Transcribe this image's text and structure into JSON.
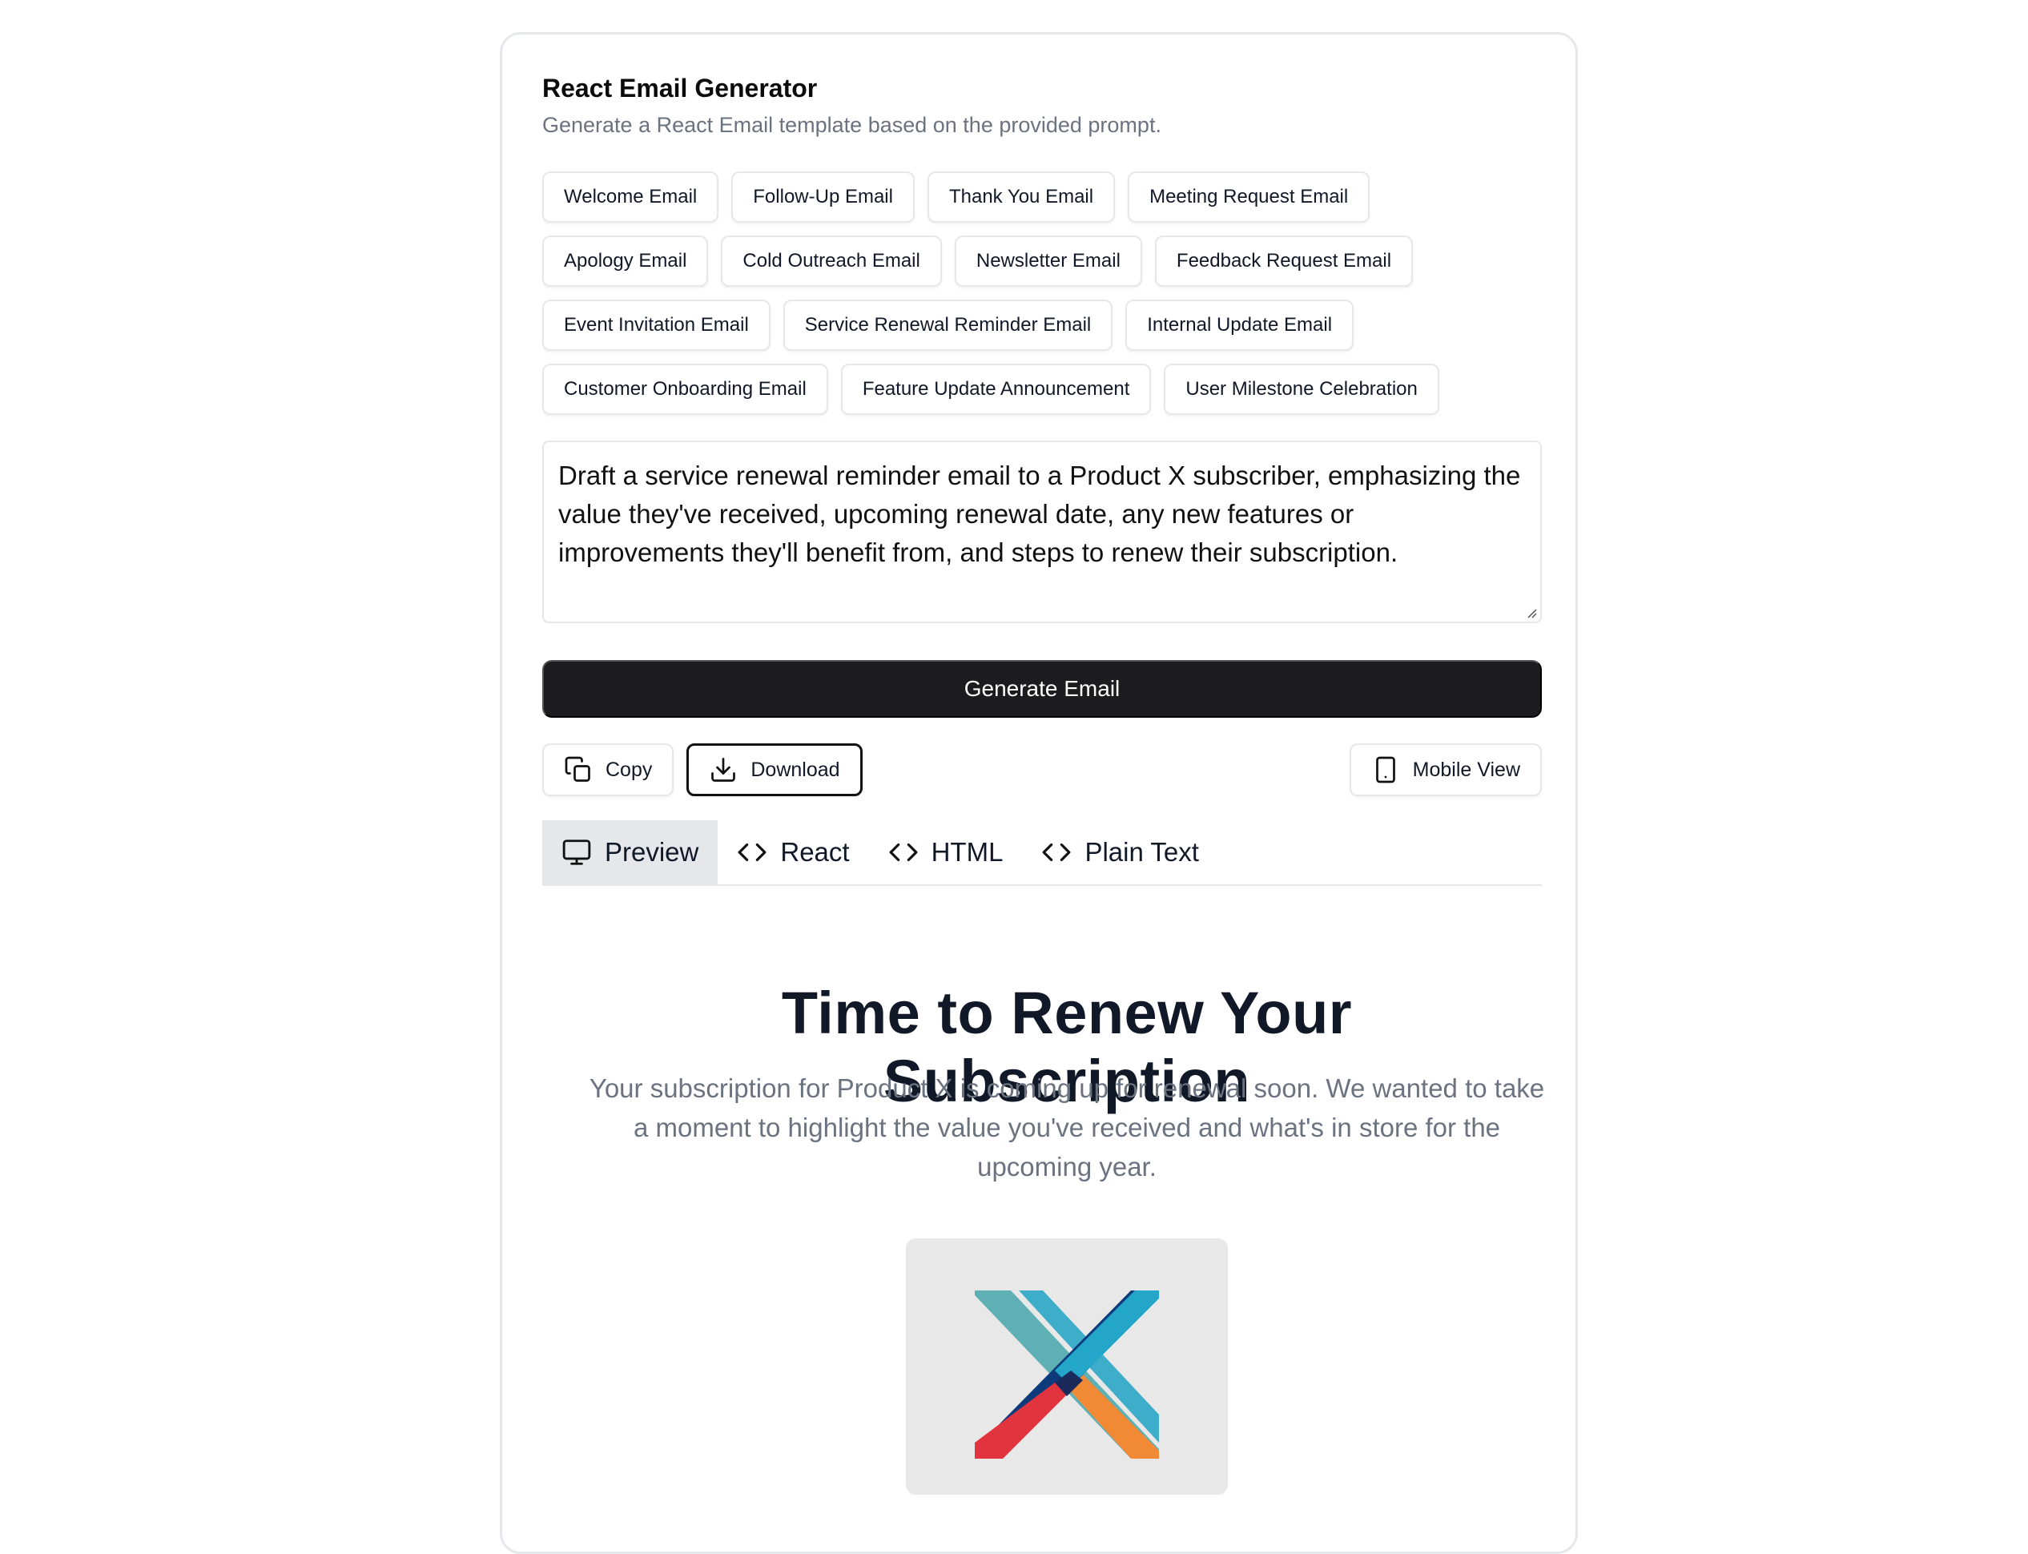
{
  "header": {
    "title": "React Email Generator",
    "subtitle": "Generate a React Email template based on the provided prompt."
  },
  "templates": [
    [
      "Welcome Email",
      "Follow-Up Email",
      "Thank You Email",
      "Meeting Request Email"
    ],
    [
      "Apology Email",
      "Cold Outreach Email",
      "Newsletter Email",
      "Feedback Request Email"
    ],
    [
      "Event Invitation Email",
      "Service Renewal Reminder Email",
      "Internal Update Email"
    ],
    [
      "Customer Onboarding Email",
      "Feature Update Announcement",
      "User Milestone Celebration"
    ]
  ],
  "prompt": {
    "value": "Draft a service renewal reminder email to a Product X subscriber, emphasizing the value they've received, upcoming renewal date, any new features or improvements they'll benefit from, and steps to renew their subscription."
  },
  "generate_button": "Generate Email",
  "actions": {
    "copy": "Copy",
    "download": "Download",
    "mobile_view": "Mobile View"
  },
  "tabs": {
    "preview": "Preview",
    "react": "React",
    "html": "HTML",
    "plain_text": "Plain Text",
    "active": "preview"
  },
  "email_preview": {
    "heading": "Time to Renew Your Subscription",
    "body": "Your subscription for Product X is coming up for renewal soon. We wanted to take a moment to highlight the value you've received and what's in store for the upcoming year.",
    "logo_icon": "product-x-logo"
  },
  "colors": {
    "primary_button": "#1c1c1e",
    "active_tab_bg": "#e5e7eb",
    "muted_text": "#6b7280",
    "border": "#e5e7eb"
  }
}
